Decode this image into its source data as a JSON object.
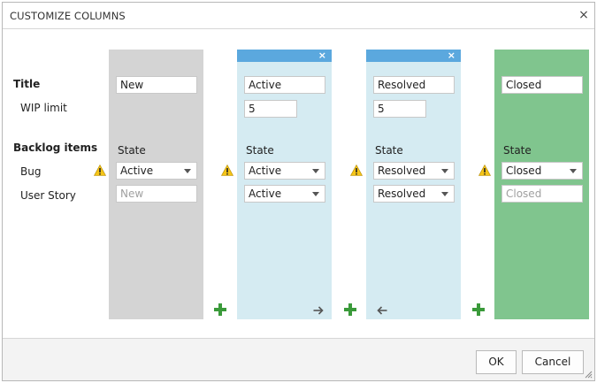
{
  "dialog": {
    "title": "CUSTOMIZE COLUMNS",
    "close_glyph": "×"
  },
  "rows": {
    "title": "Title",
    "wip_limit": "WIP limit",
    "backlog_items": "Backlog items",
    "bug": "Bug",
    "user_story": "User Story"
  },
  "columns": [
    {
      "name": "New",
      "color": "#d4d4d4",
      "state_label": "State",
      "bug_state": "Active",
      "story_state": "New",
      "story_state_placeholder": true
    },
    {
      "name": "Active",
      "color": "#d5ebf2",
      "header_color": "#5ba8de",
      "close_glyph": "×",
      "wip_limit": "5",
      "state_label": "State",
      "bug_state": "Active",
      "story_state": "Active",
      "move_icon": "arrow-right-icon"
    },
    {
      "name": "Resolved",
      "color": "#d5ebf2",
      "header_color": "#5ba8de",
      "close_glyph": "×",
      "wip_limit": "5",
      "state_label": "State",
      "bug_state": "Resolved",
      "story_state": "Resolved",
      "move_icon": "arrow-left-icon"
    },
    {
      "name": "Closed",
      "color": "#80c58e",
      "state_label": "State",
      "bug_state": "Closed",
      "story_state": "Closed",
      "story_state_placeholder": true
    }
  ],
  "icons": {
    "warning": "warning-icon",
    "add_column": "plus-icon",
    "add_color": "#3a9a3a",
    "warning_color": "#f5c518"
  },
  "footer": {
    "ok_label": "OK",
    "cancel_label": "Cancel"
  }
}
